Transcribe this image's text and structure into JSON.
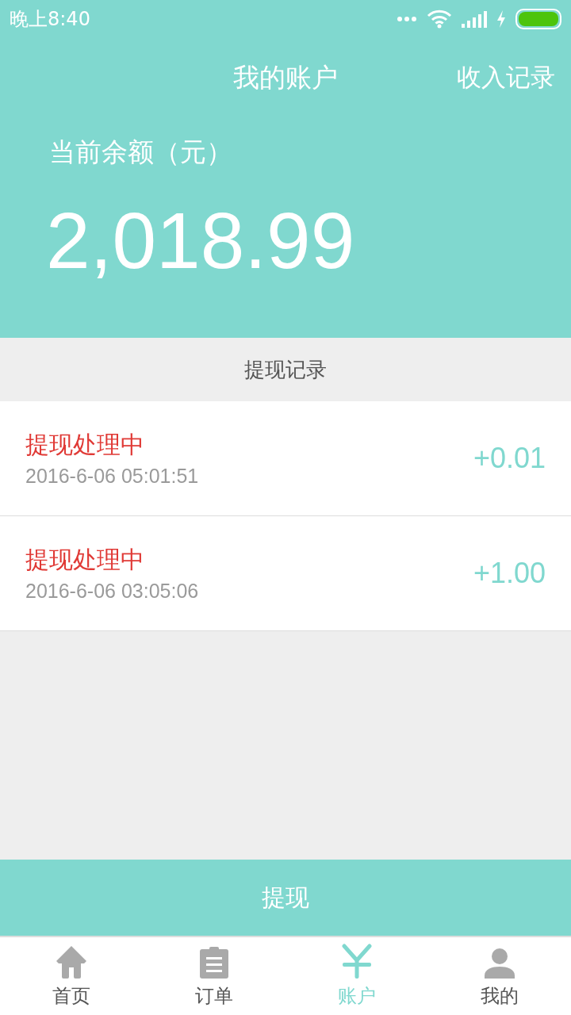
{
  "status_bar": {
    "time": "晚上8:40"
  },
  "header": {
    "title": "我的账户",
    "action": "收入记录",
    "balance_label": "当前余额（元）",
    "balance": "2,018.99"
  },
  "section_title": "提现记录",
  "records": [
    {
      "status": "提现处理中",
      "time": "2016-6-06 05:01:51",
      "amount": "+0.01"
    },
    {
      "status": "提现处理中",
      "time": "2016-6-06 03:05:06",
      "amount": "+1.00"
    }
  ],
  "withdraw_button": "提现",
  "tabs": [
    {
      "label": "首页",
      "kind": "home",
      "selected": false
    },
    {
      "label": "订单",
      "kind": "clipboard",
      "selected": false
    },
    {
      "label": "账户",
      "kind": "yen",
      "selected": true
    },
    {
      "label": "我的",
      "kind": "person",
      "selected": false
    }
  ]
}
